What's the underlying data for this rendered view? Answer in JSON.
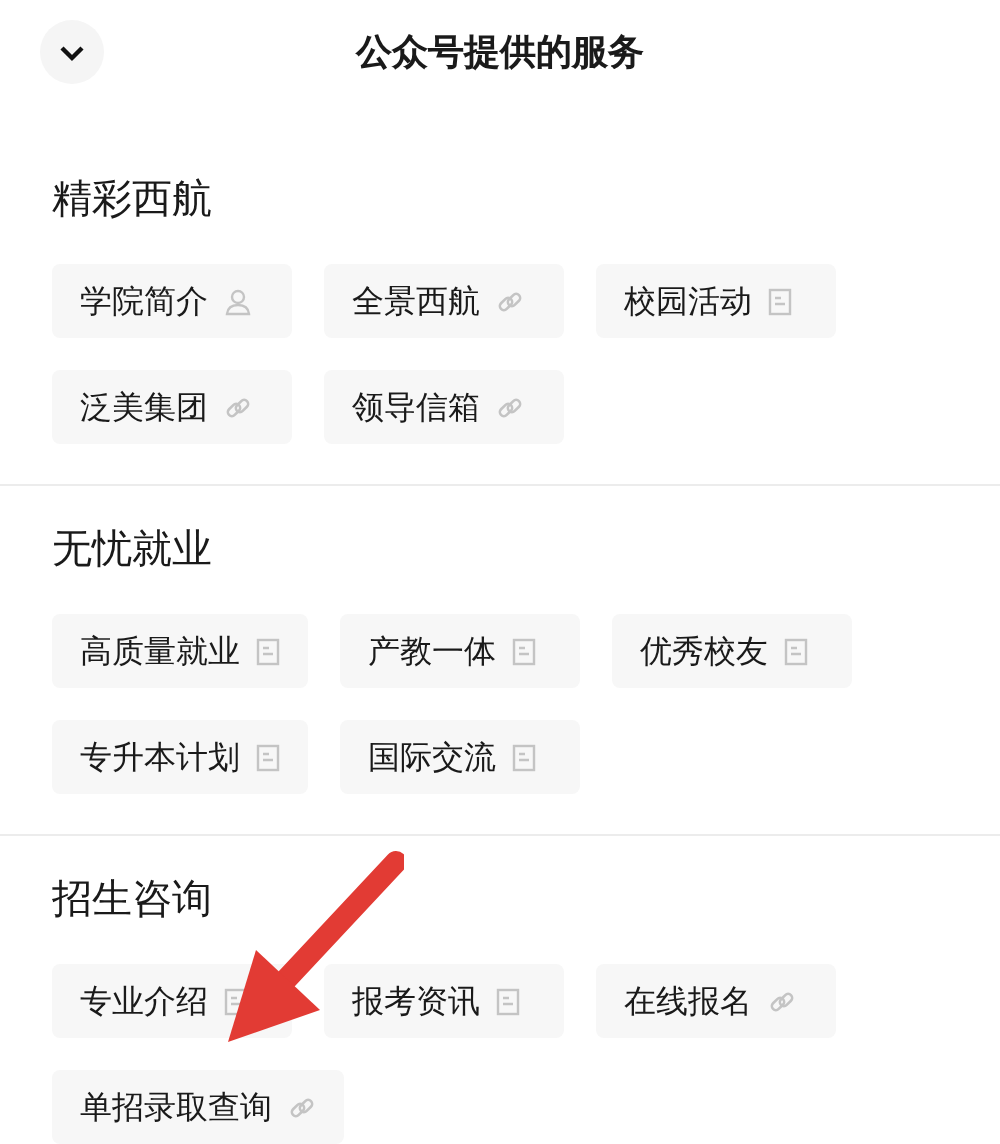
{
  "header": {
    "title": "公众号提供的服务"
  },
  "sections": [
    {
      "title": "精彩西航",
      "items": [
        {
          "label": "学院简介",
          "kind": "person"
        },
        {
          "label": "全景西航",
          "kind": "link"
        },
        {
          "label": "校园活动",
          "kind": "doc"
        },
        {
          "label": "泛美集团",
          "kind": "link"
        },
        {
          "label": "领导信箱",
          "kind": "link"
        }
      ]
    },
    {
      "title": "无忧就业",
      "items": [
        {
          "label": "高质量就业",
          "kind": "doc"
        },
        {
          "label": "产教一体",
          "kind": "doc"
        },
        {
          "label": "优秀校友",
          "kind": "doc"
        },
        {
          "label": "专升本计划",
          "kind": "doc"
        },
        {
          "label": "国际交流",
          "kind": "doc"
        }
      ]
    },
    {
      "title": "招生咨询",
      "items": [
        {
          "label": "专业介绍",
          "kind": "doc"
        },
        {
          "label": "报考资讯",
          "kind": "doc"
        },
        {
          "label": "在线报名",
          "kind": "link"
        },
        {
          "label": "单招录取查询",
          "kind": "link"
        }
      ]
    }
  ]
}
